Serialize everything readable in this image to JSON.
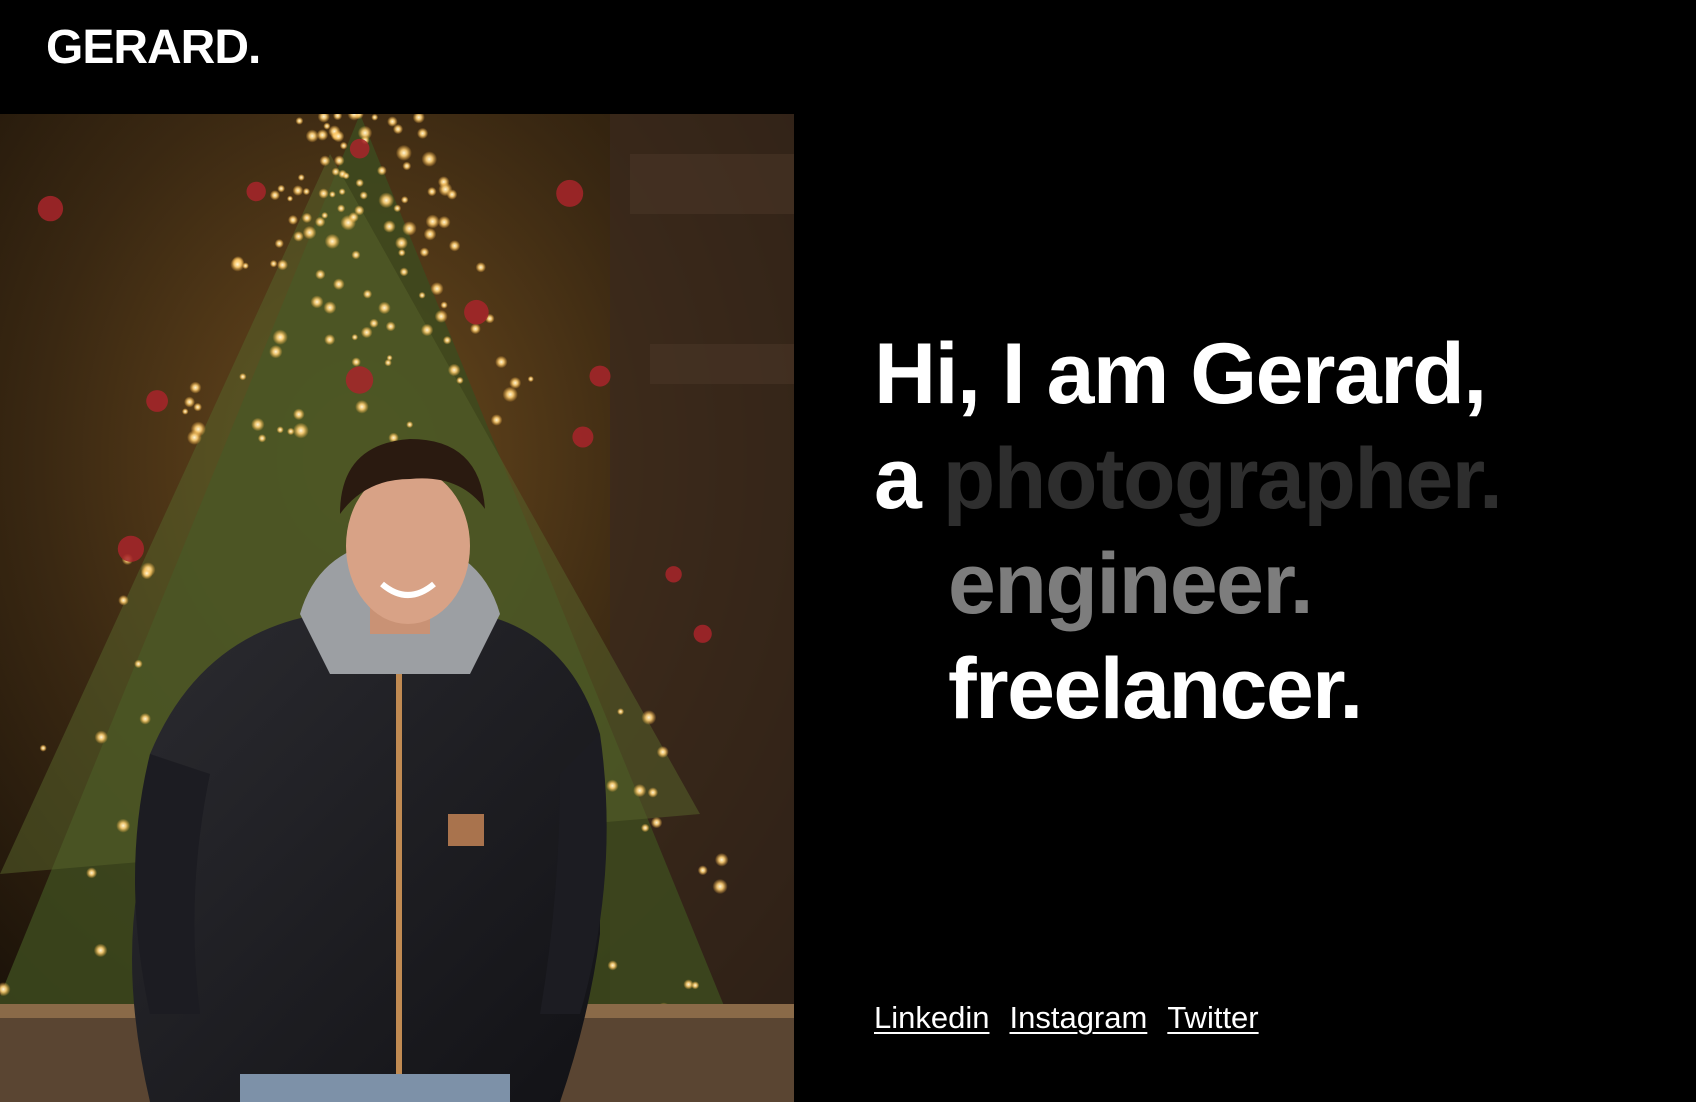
{
  "header": {
    "logo": "GERARD."
  },
  "hero": {
    "line1": "Hi, I am Gerard,",
    "article": "a",
    "roles": [
      "photographer.",
      "engineer.",
      "freelancer."
    ]
  },
  "photo": {
    "subject": "portrait-in-front-of-christmas-tree"
  },
  "socials": {
    "linkedin": "Linkedin",
    "instagram": "Instagram",
    "twitter": "Twitter"
  },
  "colors": {
    "background": "#000000",
    "text": "#ffffff",
    "role_dim": "#2e2e2e",
    "role_mid": "#7d7d7d"
  }
}
